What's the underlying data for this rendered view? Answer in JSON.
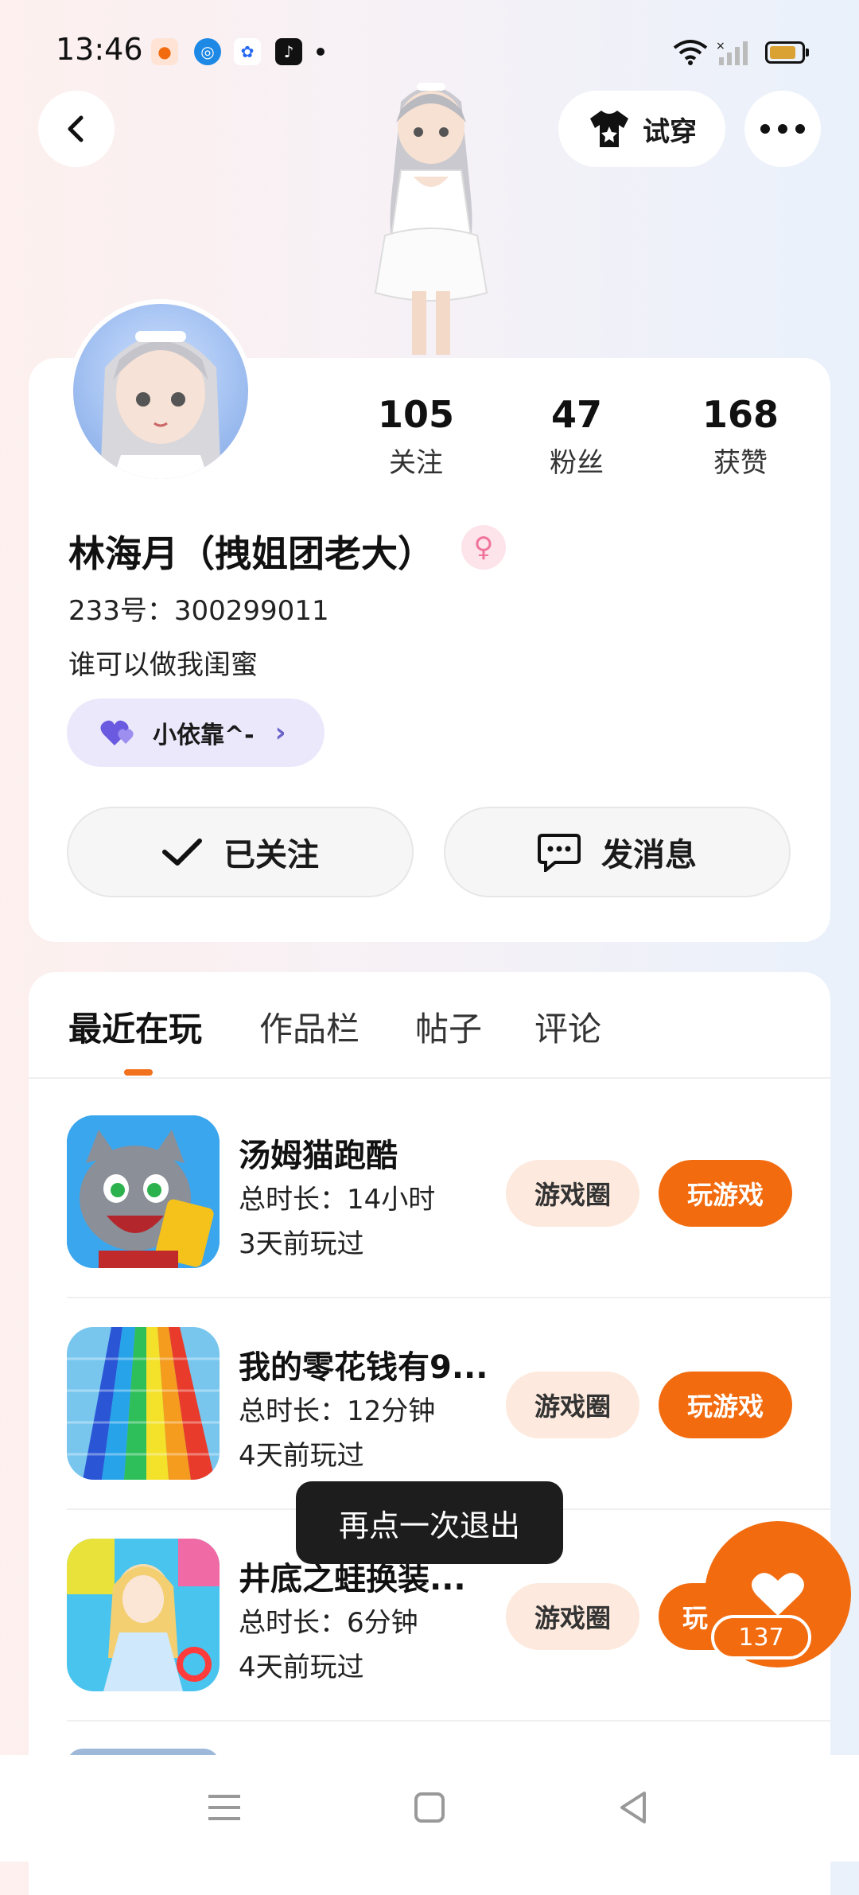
{
  "status_bar": {
    "time": "13:46",
    "apps": [
      "game-controller-icon",
      "circle-app-icon",
      "baidu-icon",
      "tiktok-icon"
    ],
    "wifi_icon": "wifi-icon",
    "signal_icon": "signal-icon",
    "battery_icon": "battery-icon"
  },
  "header": {
    "back_icon": "back-arrow-icon",
    "tryon_label": "试穿",
    "more_icon": "more-icon"
  },
  "profile": {
    "stats": [
      {
        "value": "105",
        "label": "关注"
      },
      {
        "value": "47",
        "label": "粉丝"
      },
      {
        "value": "168",
        "label": "获赞"
      }
    ],
    "name": "林海月（拽姐团老大）",
    "uid": "233号：300299011",
    "bio": "谁可以做我闺蜜",
    "tag_label": "小依靠^-",
    "follow_label": "已关注",
    "message_label": "发消息"
  },
  "tabs": [
    {
      "label": "最近在玩",
      "active": true
    },
    {
      "label": "作品栏",
      "active": false
    },
    {
      "label": "帖子",
      "active": false
    },
    {
      "label": "评论",
      "active": false
    }
  ],
  "games": [
    {
      "title": "汤姆猫跑酷",
      "duration": "总时长：14小时",
      "last_played": "3天前玩过",
      "circle_label": "游戏圈",
      "play_label": "玩游戏"
    },
    {
      "title": "我的零花钱有9...",
      "duration": "总时长：12分钟",
      "last_played": "4天前玩过",
      "circle_label": "游戏圈",
      "play_label": "玩游戏"
    },
    {
      "title": "井底之蛙换装...",
      "duration": "总时长：6分钟",
      "last_played": "4天前玩过",
      "circle_label": "游戏圈",
      "play_label": "玩"
    }
  ],
  "toast": "再点一次退出",
  "like": {
    "count": "137"
  },
  "colors": {
    "accent": "#f26b0f",
    "accent_soft": "#fde9dd",
    "tag_bg": "#ebe8fb",
    "tag_heart": "#6a5ae0"
  }
}
